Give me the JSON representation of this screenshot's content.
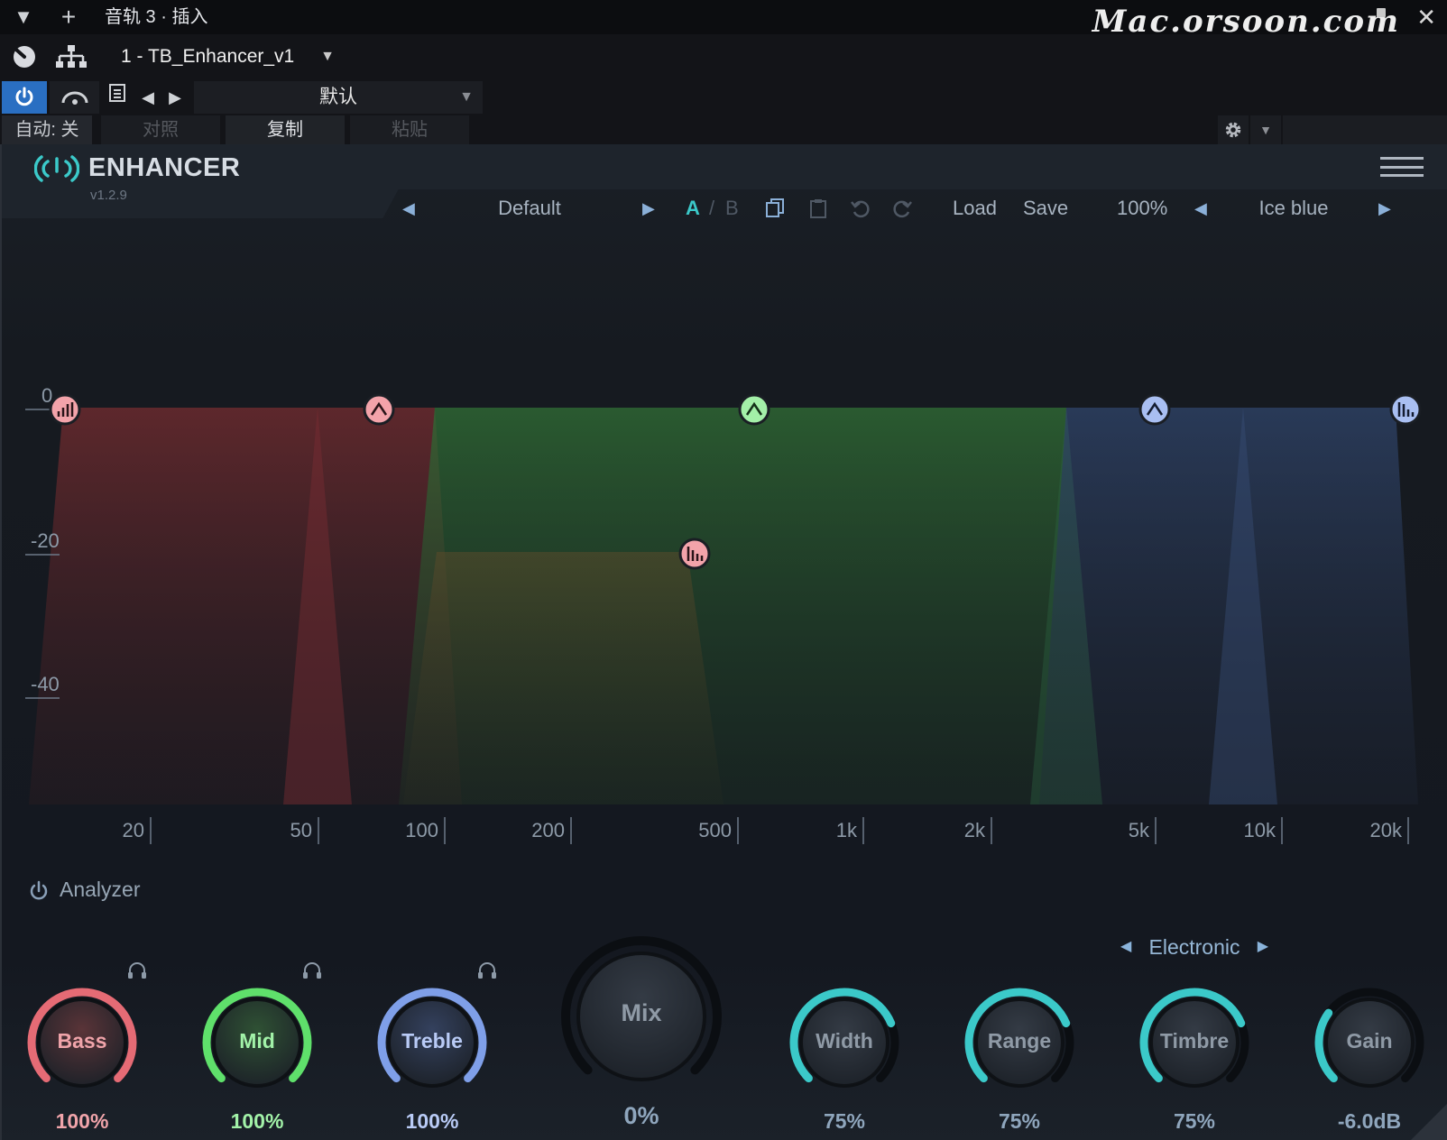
{
  "host": {
    "title": "音轨 3 · 插入",
    "watermark": "Mac.orsoon.com",
    "plugin_slot": "1 - TB_Enhancer_v1",
    "preset": "默认",
    "auto": "自动: 关",
    "compare": "对照",
    "copy": "复制",
    "paste": "粘贴"
  },
  "plugin": {
    "name": "ENHANCER",
    "version": "v1.2.9",
    "preset_name": "Default",
    "ab_a": "A",
    "ab_sep": "/",
    "ab_b": "B",
    "load": "Load",
    "save": "Save",
    "zoom": "100%",
    "theme": "Ice blue"
  },
  "graph": {
    "y_labels": [
      "0",
      "-20",
      "-40"
    ],
    "x_labels": [
      "20",
      "50",
      "100",
      "200",
      "500",
      "1k",
      "2k",
      "5k",
      "10k",
      "20k"
    ]
  },
  "analyzer": "Analyzer",
  "genre": "Electronic",
  "knobs": [
    {
      "label": "Bass",
      "value": "100%",
      "color": "#e56b75",
      "label_color": "#f0a4aa",
      "fraction": 1.0
    },
    {
      "label": "Mid",
      "value": "100%",
      "color": "#5fe06b",
      "label_color": "#a2f2a8",
      "fraction": 1.0
    },
    {
      "label": "Treble",
      "value": "100%",
      "color": "#7f9fe8",
      "label_color": "#b9cbf6",
      "fraction": 1.0
    },
    {
      "label": "Mix",
      "value": "0%",
      "color": "#3bc9c9",
      "label_color": "#8f9aa6",
      "fraction": 0.0
    },
    {
      "label": "Width",
      "value": "75%",
      "color": "#3bc9c9",
      "label_color": "#8f9aa6",
      "fraction": 0.75
    },
    {
      "label": "Range",
      "value": "75%",
      "color": "#3bc9c9",
      "label_color": "#8f9aa6",
      "fraction": 0.75
    },
    {
      "label": "Timbre",
      "value": "75%",
      "color": "#3bc9c9",
      "label_color": "#8f9aa6",
      "fraction": 0.75
    },
    {
      "label": "Gain",
      "value": "-6.0dB",
      "color": "#3bc9c9",
      "label_color": "#8f9aa6",
      "fraction": 0.3
    }
  ],
  "colors": {
    "accent": "#3bc9c9",
    "host_power": "#2a6fc2",
    "bass_band": "#e56b75",
    "mid_band": "#5fe06b",
    "treble_band": "#7f9fe8"
  }
}
